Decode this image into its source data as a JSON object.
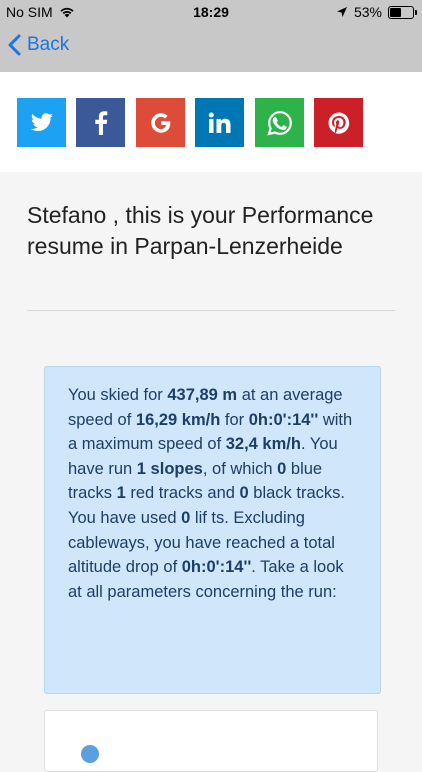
{
  "status": {
    "carrier": "No SIM",
    "time": "18:29",
    "battery": "53%",
    "battery_level": 0.53
  },
  "nav": {
    "back_label": "Back"
  },
  "share": {
    "buttons": [
      {
        "name": "twitter",
        "color": "#1da1f2"
      },
      {
        "name": "facebook",
        "color": "#3b5998"
      },
      {
        "name": "google",
        "color": "#dd4b39"
      },
      {
        "name": "linkedin",
        "color": "#0077b5"
      },
      {
        "name": "whatsapp",
        "color": "#2eb34a"
      },
      {
        "name": "pinterest",
        "color": "#cb2027"
      }
    ]
  },
  "main": {
    "title": "Stefano , this is your Performance resume in Parpan-Lenzerheide",
    "summary": {
      "t1": "You skied for ",
      "distance": "437,89 m",
      "t2": " at an average speed of ",
      "avg_speed": "16,29 km/h",
      "t3": " for ",
      "duration": "0h:0':14''",
      "t4": " with a maximum speed of ",
      "max_speed": "32,4 km/h",
      "t5": ". You have run ",
      "slopes": "1 slopes",
      "t6": ", of which ",
      "blue": "0",
      "t7": " blue tracks ",
      "red": "1",
      "t8": " red tracks and ",
      "black": "0",
      "t9": " black tracks. You have used ",
      "lifts": "0",
      "t10": " lif ts. Excluding cableways, you have reached a total altitude drop of ",
      "altitude": "0h:0':14''",
      "t11": ". Take a look at all parameters concerning the run:"
    }
  }
}
